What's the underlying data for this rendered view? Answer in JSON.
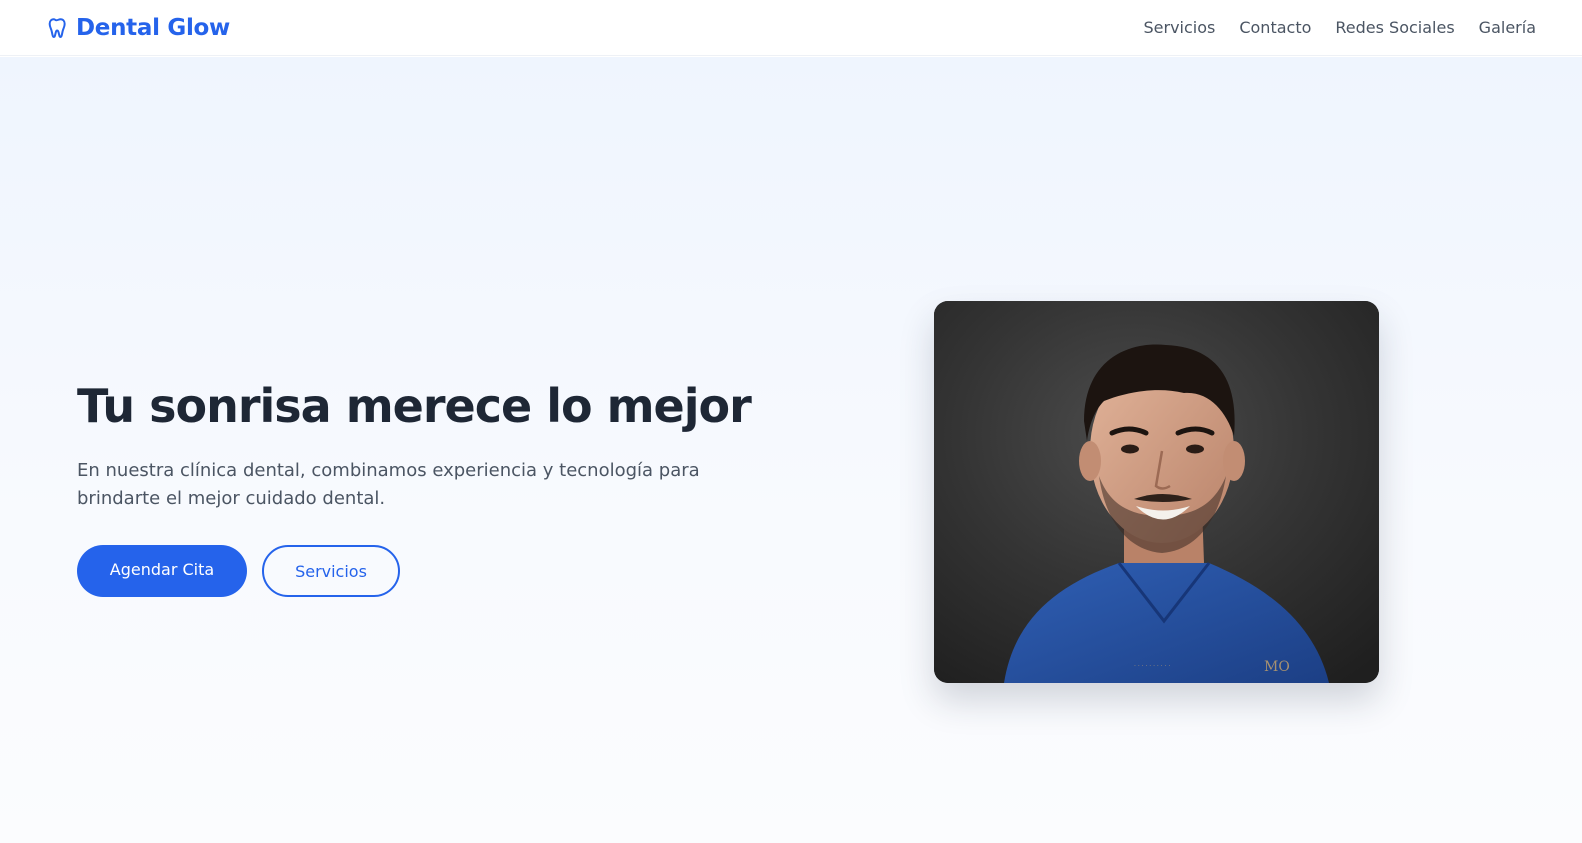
{
  "brand": {
    "name": "Dental Glow",
    "icon": "tooth-icon",
    "color": "#2563eb"
  },
  "nav": {
    "links": [
      "Servicios",
      "Contacto",
      "Redes Sociales",
      "Galería"
    ]
  },
  "hero": {
    "title": "Tu sonrisa merece lo mejor",
    "subtitle": "En nuestra clínica dental, combinamos experiencia y tecnología para brindarte el mejor cuidado dental.",
    "primary_button": "Agendar Cita",
    "secondary_button": "Servicios"
  },
  "colors": {
    "accent": "#2563eb",
    "heading": "#1e2735",
    "body_text": "#4b5563"
  }
}
